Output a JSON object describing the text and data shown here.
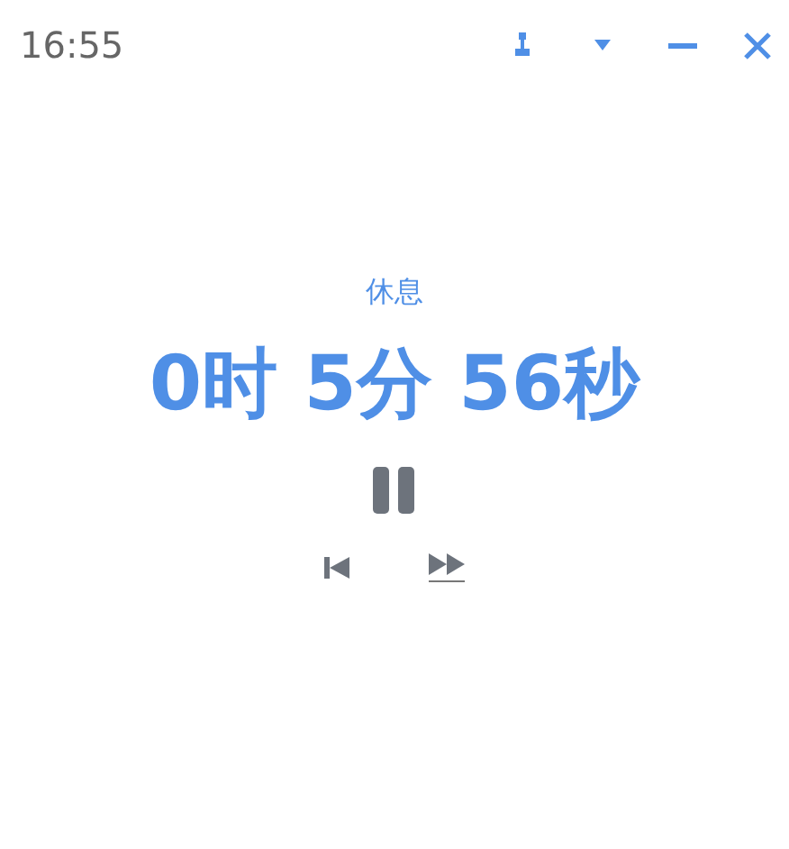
{
  "clock": "16:55",
  "phase": "休息",
  "timer": "0时 5分 56秒"
}
